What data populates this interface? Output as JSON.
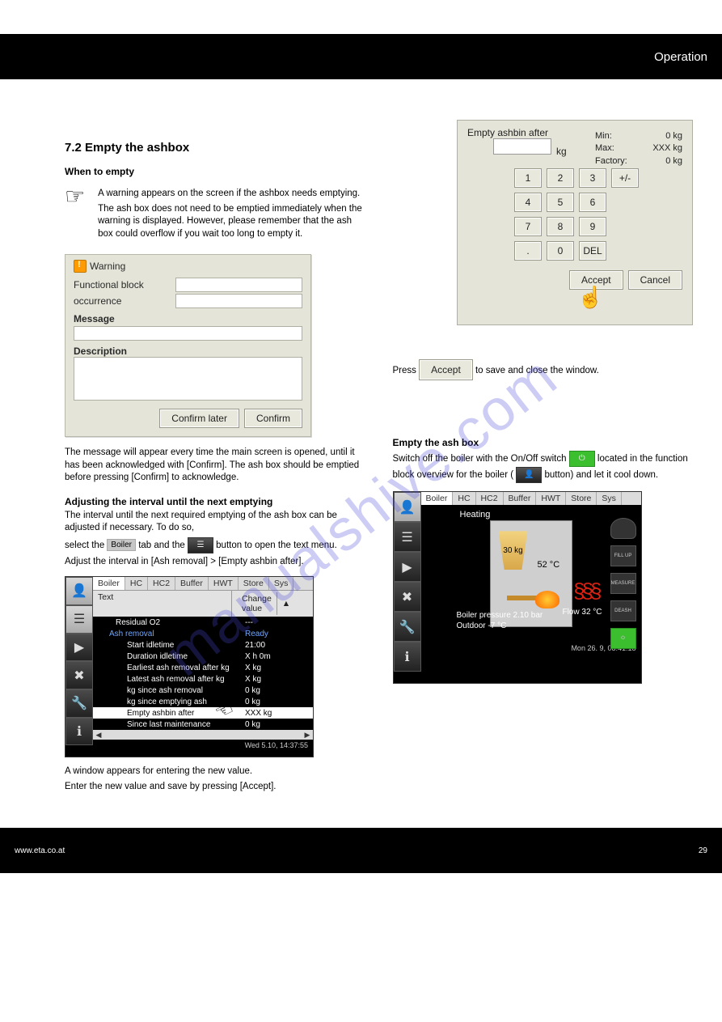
{
  "header": {
    "title": "Operation"
  },
  "footer": {
    "left": "www.eta.co.at",
    "right": "29"
  },
  "watermark": "manualshive.com",
  "left": {
    "section_title": "7.2 Empty the ashbox",
    "sub_title": "When to empty",
    "note_icon": "☞",
    "note_p1": "A warning appears on the screen if the ashbox needs emptying.",
    "note_p2": "The ash box does not need to be emptied immediately when the warning is displayed. However, please remember that the ash box could overflow if you wait too long to empty it.",
    "after_dlg": "The message will appear every time the main screen is opened, until it has been acknowledged with [Confirm]. The ash box should be emptied before pressing [Confirm] to acknowledge.",
    "sub_title2": "Adjusting the interval until the next emptying",
    "interval_p1": "The interval until the next required emptying of the ash box can be adjusted if necessary. To do so,",
    "interval_p2_prefix": "select the ",
    "interval_btn": "Boiler",
    "interval_p2_mid": " tab and the ",
    "interval_p2_suffix": " button to open the text menu.",
    "interval_p3": "Adjust the interval in [Ash removal] > [Empty ashbin after].",
    "under_touch1": "A window appears for entering the new value.",
    "under_touch2": "Enter the new value and save by pressing [Accept]."
  },
  "right": {
    "after_keypad_p1_prefix": "Press ",
    "after_keypad_p1_suffix": " to save and close the window.",
    "sub_title3": "Empty the ash box",
    "steps_p1": "Switch off the boiler with the On/Off switch",
    "steps_p1b": "located in the function block overview for the boiler (",
    "steps_p1c": " button) and let it cool down."
  },
  "warning_dialog": {
    "title": "Warning",
    "lbl_block": "Functional block",
    "lbl_occurrence": "occurrence",
    "lbl_message": "Message",
    "lbl_description": "Description",
    "btn_later": "Confirm later",
    "btn_confirm": "Confirm"
  },
  "touch_list": {
    "tabs": [
      "Boiler",
      "HC",
      "HC2",
      "Buffer",
      "HWT",
      "Store",
      "Sys"
    ],
    "col_text": "Text",
    "col_value": "Change value",
    "rows": [
      {
        "t": "Residual O2",
        "v": "---",
        "cls": "ind1"
      },
      {
        "t": "Ash removal",
        "v": "Ready",
        "cls": "blue"
      },
      {
        "t": "Start idletime",
        "v": "21:00",
        "cls": "ind2"
      },
      {
        "t": "Duration idletime",
        "v": "X h 0m",
        "cls": "ind2"
      },
      {
        "t": "Earliest ash removal after kg",
        "v": "X kg",
        "cls": "ind2"
      },
      {
        "t": "Latest ash removal after kg",
        "v": "X kg",
        "cls": "ind2"
      },
      {
        "t": "kg since ash removal",
        "v": "0 kg",
        "cls": "ind2"
      },
      {
        "t": "kg since emptying ash",
        "v": "0 kg",
        "cls": "ind2"
      },
      {
        "t": "Empty ashbin after",
        "v": "XXX kg",
        "cls": "ind2 sel"
      },
      {
        "t": "Since last maintenance",
        "v": "0 kg",
        "cls": "ind2"
      }
    ],
    "footer_time": "Wed 5.10, 14:37:55"
  },
  "keypad": {
    "title": "Empty ashbin after",
    "unit": "kg",
    "limits": [
      {
        "lab": "Min:",
        "val": "0 kg"
      },
      {
        "lab": "Max:",
        "val": "XXX kg"
      },
      {
        "lab": "Factory:",
        "val": "0 kg"
      }
    ],
    "keys": [
      "1",
      "2",
      "3",
      "+/-",
      "4",
      "5",
      "6",
      "",
      "7",
      "8",
      "9",
      "",
      ".",
      "0",
      "DEL",
      ""
    ],
    "accept": "Accept",
    "cancel": "Cancel"
  },
  "accept_standalone": "Accept",
  "boiler_screen": {
    "tabs": [
      "Boiler",
      "HC",
      "HC2",
      "Buffer",
      "HWT",
      "Store",
      "Sys"
    ],
    "status": "Heating",
    "hopper": "30 kg",
    "temp": "52 °C",
    "flow": "Flow 32 °C",
    "info1": "Boiler pressure 2.10 bar",
    "info2": "Outdoor -7 °C",
    "footer_time": "Mon 26. 9, 08:41:18",
    "right_btns": [
      "FILL UP",
      "MEASURE",
      "DEASH"
    ]
  }
}
